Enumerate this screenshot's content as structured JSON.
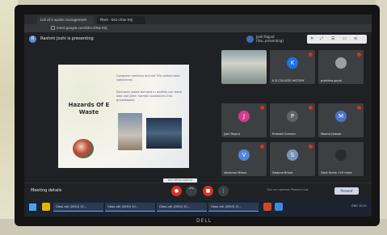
{
  "browser": {
    "tab_title": "List of e waste management",
    "tab2_title": "Meet - bhz-cthw-mtj",
    "url": "meet.google.com/bhz-cthw-mtj"
  },
  "meet": {
    "presenter_text": "Rashmi Joshi is presenting",
    "presenter_initial": "R",
    "host_name": "Jyoti Rajput",
    "host_sub": "(You, presenting)"
  },
  "slide": {
    "title": "Hazards Of E Waste",
    "text1": "Computer monitors and old TVs contain toxic substances",
    "text2": "Electronic waste dumped in landfills can leach lead and other harmful substances into groundwater."
  },
  "participants": [
    {
      "initial": "K",
      "name": "K D COLLEGE HISTORY",
      "color": "#1a73e8"
    },
    {
      "initial": "",
      "name": "prarthna goyal",
      "color": "#9aa0a6"
    },
    {
      "initial": "J",
      "name": "Jyoti Rajput",
      "color": "#d33b8f"
    },
    {
      "initial": "P",
      "name": "Prakash Gurnani",
      "color": "#5f6368"
    },
    {
      "initial": "M",
      "name": "Maansi Jaiswal",
      "color": "#4a76c8"
    },
    {
      "initial": "V",
      "name": "Vaishnavi Bhoot",
      "color": "#4f86d6"
    },
    {
      "initial": "S",
      "name": "Swapna Bhoot",
      "color": "#7c94b8"
    },
    {
      "initial": "",
      "name": "Sejal Hinda +29 more",
      "color": "#2b2b2b"
    }
  ],
  "controls": {
    "meeting_details": "Meeting details",
    "tooltip": "Turn off microphone",
    "mic_icon": "●",
    "end_icon": "⌒",
    "cam_icon": "■",
    "more_icon": "⋮",
    "right_tools_text": "Turn on captions     Present now",
    "present_label": "Present"
  },
  "taskbar": {
    "items": [
      "Class call (2020) 10...",
      "Class call (2020) 10...",
      "Class call (2020) 10...",
      "Class call (2020) 11..."
    ],
    "right_text": "ENG  10:21"
  },
  "monitor_brand": "DELL"
}
